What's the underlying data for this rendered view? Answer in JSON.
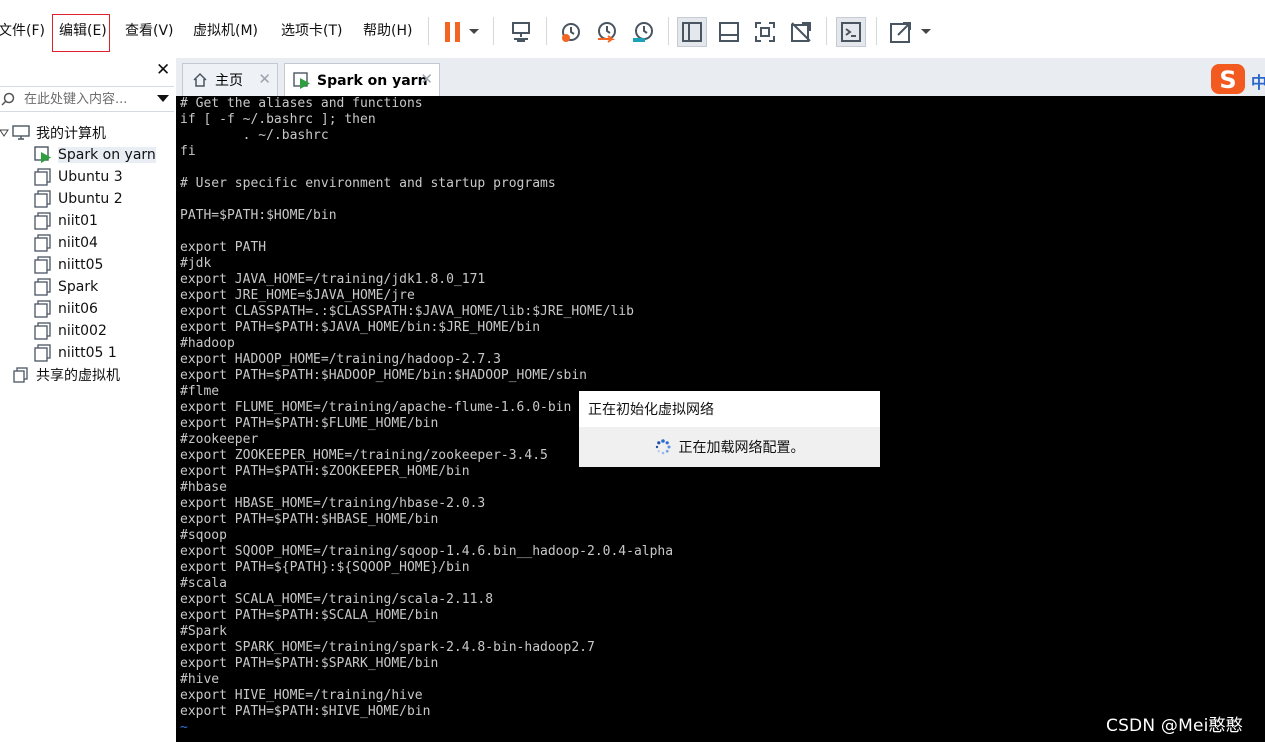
{
  "menu": {
    "file": "文件(F)",
    "edit": "编辑(E)",
    "view": "查看(V)",
    "vm": "虚拟机(M)",
    "tabs": "选项卡(T)",
    "help": "帮助(H)"
  },
  "toolbar": {
    "icons": [
      "pause-icon",
      "dropdown-arrow-icon",
      "send-ctrl-alt-del-icon",
      "snapshot-take-icon",
      "snapshot-revert-icon",
      "snapshot-manager-icon",
      "show-library-icon",
      "thumbnail-bar-icon",
      "full-screen-icon",
      "unity-icon",
      "console-view-icon",
      "stretch-icon",
      "dropdown-arrow-icon"
    ],
    "pause_color": "#f26522"
  },
  "library": {
    "search_placeholder": "在此处键入内容...",
    "root_label": "我的计算机",
    "vms": [
      "Spark on yarn",
      "Ubuntu 3",
      "Ubuntu 2",
      "niit01",
      "niit04",
      "niitt05",
      "Spark",
      "niit06",
      "niit002",
      "niitt05 1"
    ],
    "selected_vm": "Spark on yarn",
    "shared_label": "共享的虚拟机"
  },
  "tabs": [
    {
      "label": "主页",
      "icon": "home-icon"
    },
    {
      "label": "Spark on yarn",
      "icon": "vm-running-icon"
    }
  ],
  "terminal": {
    "lines": [
      "# Get the aliases and functions",
      "if [ -f ~/.bashrc ]; then",
      "        . ~/.bashrc",
      "fi",
      "",
      "# User specific environment and startup programs",
      "",
      "PATH=$PATH:$HOME/bin",
      "",
      "export PATH",
      "#jdk",
      "export JAVA_HOME=/training/jdk1.8.0_171",
      "export JRE_HOME=$JAVA_HOME/jre",
      "export CLASSPATH=.:$CLASSPATH:$JAVA_HOME/lib:$JRE_HOME/lib",
      "export PATH=$PATH:$JAVA_HOME/bin:$JRE_HOME/bin",
      "#hadoop",
      "export HADOOP_HOME=/training/hadoop-2.7.3",
      "export PATH=$PATH:$HADOOP_HOME/bin:$HADOOP_HOME/sbin",
      "#flme",
      "export FLUME_HOME=/training/apache-flume-1.6.0-bin",
      "export PATH=$PATH:$FLUME_HOME/bin",
      "#zookeeper",
      "export ZOOKEEPER_HOME=/training/zookeeper-3.4.5",
      "export PATH=$PATH:$ZOOKEEPER_HOME/bin",
      "#hbase",
      "export HBASE_HOME=/training/hbase-2.0.3",
      "export PATH=$PATH:$HBASE_HOME/bin",
      "#sqoop",
      "export SQOOP_HOME=/training/sqoop-1.4.6.bin__hadoop-2.0.4-alpha",
      "export PATH=${PATH}:${SQOOP_HOME}/bin",
      "#scala",
      "export SCALA_HOME=/training/scala-2.11.8",
      "export PATH=$PATH:$SCALA_HOME/bin",
      "#Spark",
      "export SPARK_HOME=/training/spark-2.4.8-bin-hadoop2.7",
      "export PATH=$PATH:$SPARK_HOME/bin",
      "#hive",
      "export HIVE_HOME=/training/hive",
      "export PATH=$PATH:$HIVE_HOME/bin",
      "~",
      "~"
    ],
    "text_color": "#c8c8c8",
    "tilde_color": "#3a6fd8"
  },
  "dialog": {
    "title": "正在初始化虚拟网络",
    "message": "正在加载网络配置。"
  },
  "ime": {
    "brand": "S",
    "mode": "中"
  },
  "watermark": "CSDN @Mei憨憨"
}
